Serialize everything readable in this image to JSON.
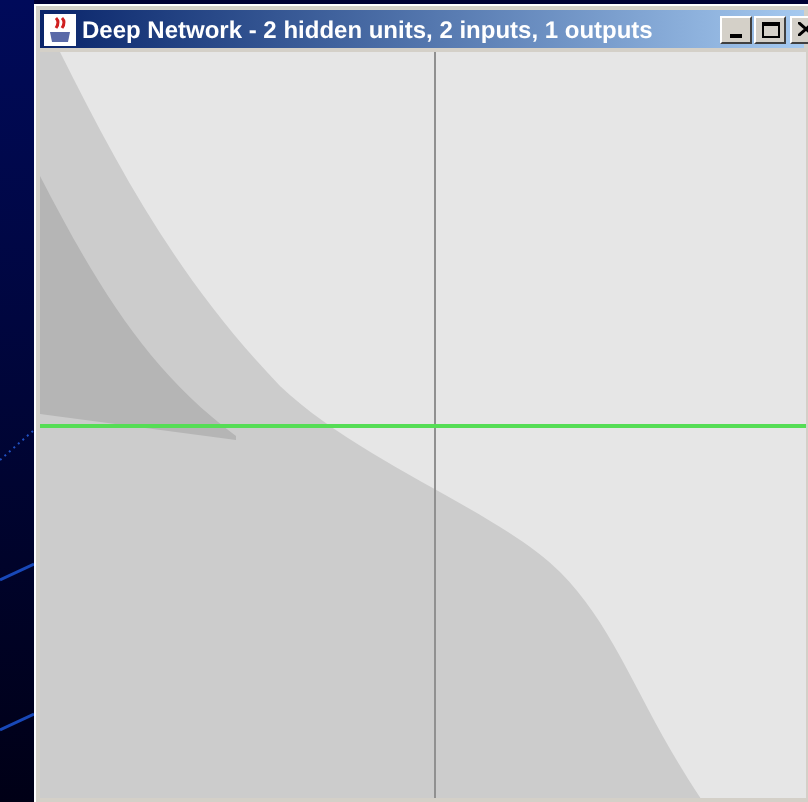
{
  "window": {
    "title": "Deep Network - 2 hidden units, 2 inputs, 1 outputs"
  }
}
